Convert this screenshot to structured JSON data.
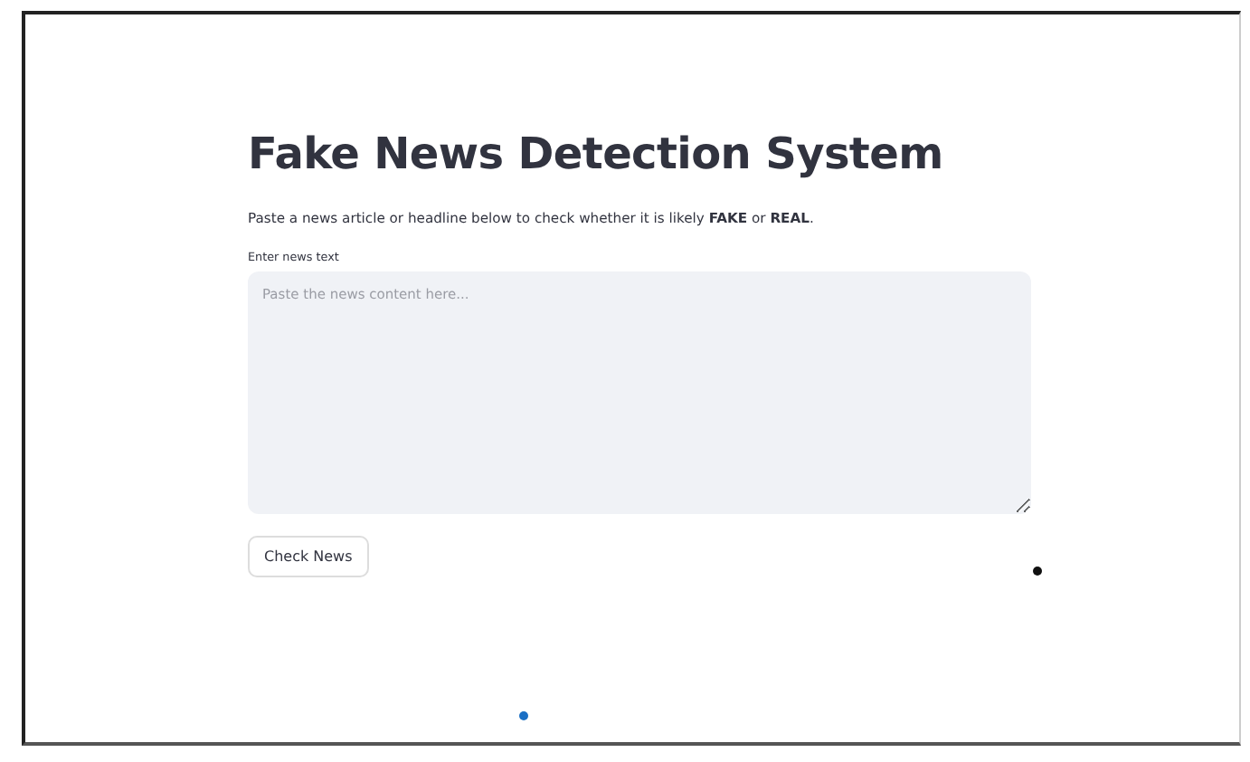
{
  "title": "Fake News Detection System",
  "description": "Paste a news article or headline below to check whether it is likely **FAKE** or **REAL**.",
  "news_field": {
    "label": "Enter news text",
    "placeholder": "Paste the news content here..."
  },
  "buttons": [
    "Check News"
  ]
}
